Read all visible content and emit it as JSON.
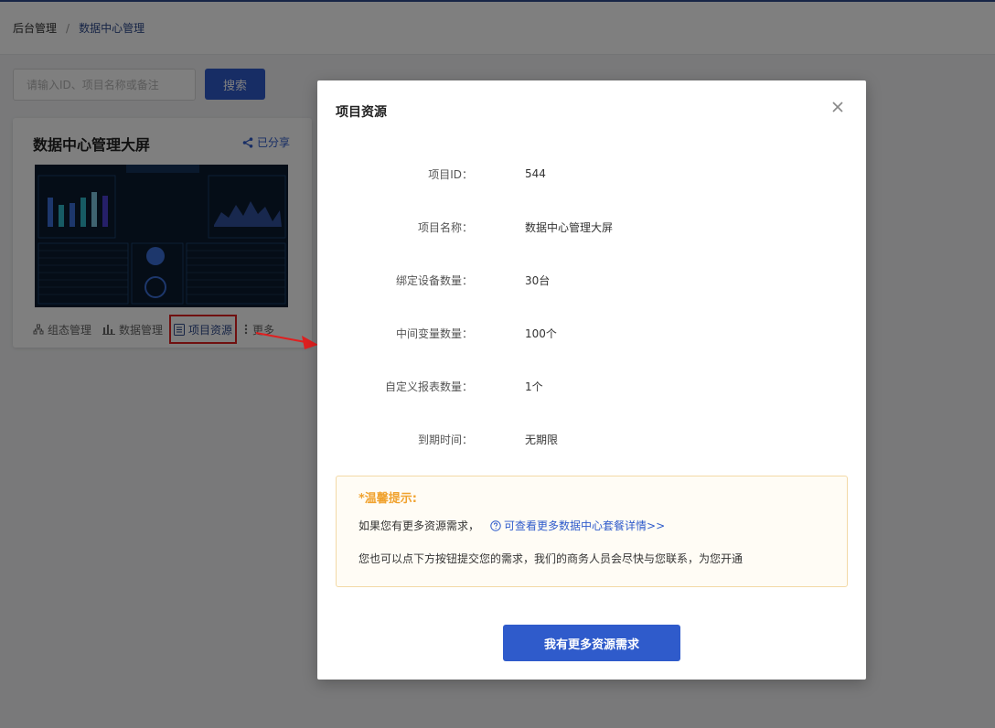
{
  "breadcrumb": {
    "root": "后台管理",
    "separator": "/",
    "current": "数据中心管理"
  },
  "search": {
    "placeholder": "请输入ID、项目名称或备注",
    "value": "",
    "button_label": "搜索"
  },
  "card": {
    "title": "数据中心管理大屏",
    "share_label": "已分享",
    "actions": [
      {
        "label": "组态管理",
        "icon": "topology-icon"
      },
      {
        "label": "数据管理",
        "icon": "bar-chart-icon"
      },
      {
        "label": "项目资源",
        "icon": "document-list-icon"
      },
      {
        "label": "更多",
        "icon": "more-vertical-icon"
      }
    ]
  },
  "modal": {
    "title": "项目资源",
    "fields": [
      {
        "label": "项目ID：",
        "value": "544"
      },
      {
        "label": "项目名称：",
        "value": "数据中心管理大屏"
      },
      {
        "label": "绑定设备数量：",
        "value": "30台"
      },
      {
        "label": "中间变量数量：",
        "value": "100个"
      },
      {
        "label": "自定义报表数量：",
        "value": "1个"
      },
      {
        "label": "到期时间：",
        "value": "无期限"
      }
    ],
    "tip": {
      "title": "*温馨提示:",
      "line1": "如果您有更多资源需求，",
      "link": "可查看更多数据中心套餐详情>>",
      "line2": "您也可以点下方按钮提交您的需求，我们的商务人员会尽快与您联系，为您开通"
    },
    "submit_label": "我有更多资源需求"
  },
  "colors": {
    "primary": "#2f5bcb",
    "nav_dark": "#2f4a8c",
    "tip_orange": "#f0a22e",
    "highlight_red": "#e02020"
  }
}
